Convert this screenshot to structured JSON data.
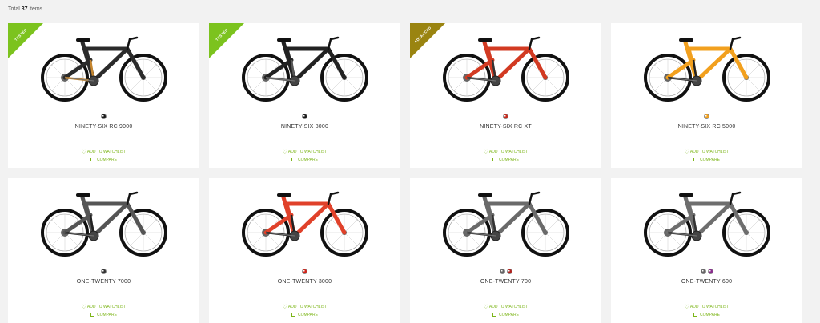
{
  "total": {
    "prefix": "Total",
    "count": "37",
    "suffix": "items."
  },
  "labels": {
    "watchlist": "ADD TO WATCHLIST",
    "compare": "COMPARE"
  },
  "products": [
    {
      "name": "NINETY-SIX RC 9000",
      "badge": "TESTED",
      "badge_color": "#7cc31e",
      "frame_color": "#2b2b2b",
      "accent_color": "#c6862e",
      "swatches": [
        "#1a1a1a"
      ]
    },
    {
      "name": "NINETY-SIX 8000",
      "badge": "TESTED",
      "badge_color": "#7cc31e",
      "frame_color": "#222222",
      "accent_color": "#555555",
      "swatches": [
        "#1a1a1a"
      ]
    },
    {
      "name": "NINETY-SIX RC XT",
      "badge": "ADVANCED",
      "badge_color": "#9a8410",
      "frame_color": "#d23a22",
      "accent_color": "#333333",
      "swatches": [
        "#c8281c"
      ]
    },
    {
      "name": "NINETY-SIX RC 5000",
      "badge": "",
      "badge_color": "",
      "frame_color": "#f2a01e",
      "accent_color": "#222222",
      "swatches": [
        "#f2a01e"
      ]
    },
    {
      "name": "ONE-TWENTY 7000",
      "badge": "",
      "badge_color": "",
      "frame_color": "#555555",
      "accent_color": "#222222",
      "swatches": [
        "#333333"
      ]
    },
    {
      "name": "ONE-TWENTY 3000",
      "badge": "",
      "badge_color": "",
      "frame_color": "#e0412a",
      "accent_color": "#222222",
      "swatches": [
        "#d3241a"
      ]
    },
    {
      "name": "ONE-TWENTY 700",
      "badge": "",
      "badge_color": "",
      "frame_color": "#6a6a6a",
      "accent_color": "#333333",
      "swatches": [
        "#666666",
        "#b3201c"
      ]
    },
    {
      "name": "ONE-TWENTY 600",
      "badge": "",
      "badge_color": "",
      "frame_color": "#6e6e6e",
      "accent_color": "#333333",
      "swatches": [
        "#666666",
        "#8a2a8e"
      ]
    }
  ]
}
